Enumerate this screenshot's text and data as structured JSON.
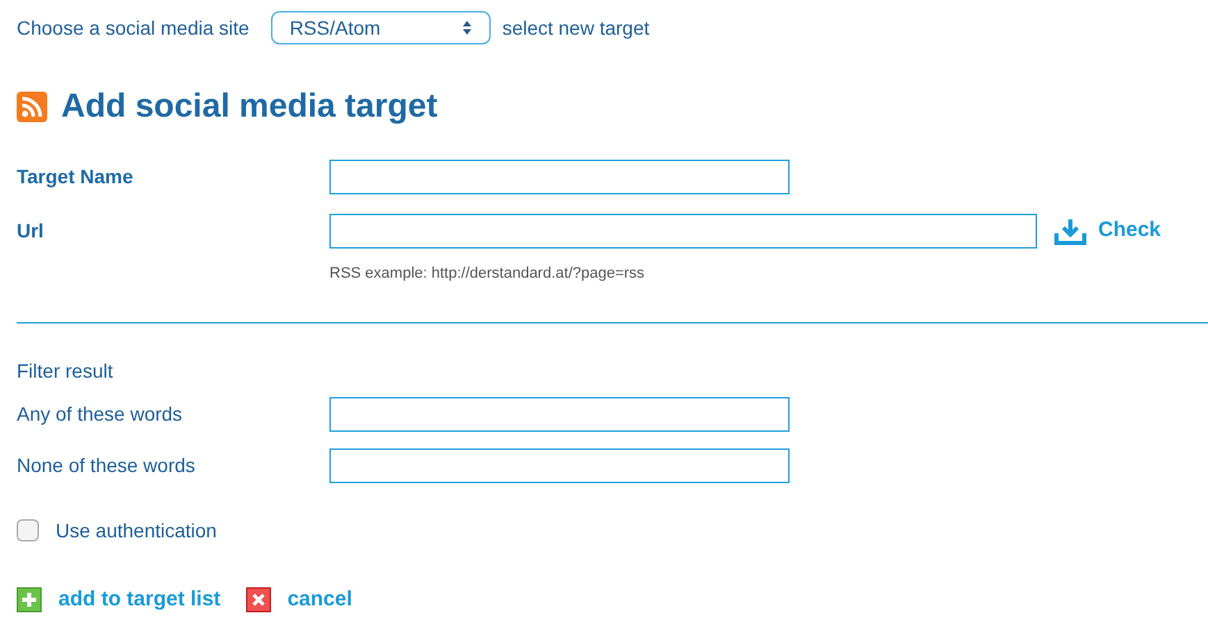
{
  "site_picker": {
    "label": "Choose a social media site",
    "value": "RSS/Atom",
    "hint": "select new target"
  },
  "title": "Add social media target",
  "fields": [
    {
      "label": "Target Name",
      "kind": "short"
    },
    {
      "label": "Url",
      "kind": "url",
      "action": "Check",
      "example": "RSS example: http://derstandard.at/?page=rss"
    }
  ],
  "filter": {
    "heading": "Filter result",
    "fields": [
      {
        "label": "Any of these words"
      },
      {
        "label": "None of these words"
      }
    ]
  },
  "auth": {
    "label": "Use authentication",
    "checked": false
  },
  "actions": [
    {
      "label": "add to target list",
      "kind": "add"
    },
    {
      "label": "cancel",
      "kind": "cancel"
    }
  ]
}
